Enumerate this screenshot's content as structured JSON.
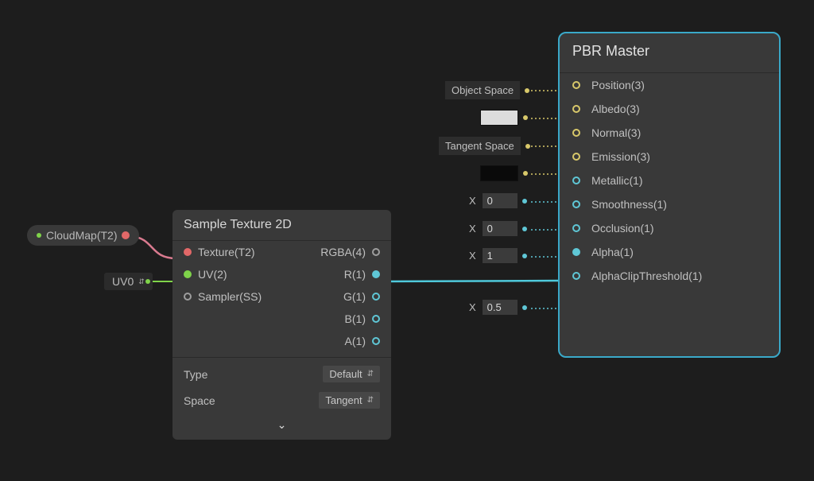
{
  "cloudmap": {
    "label": "CloudMap(T2)"
  },
  "uv_pill": {
    "label": "UV0"
  },
  "sample_node": {
    "title": "Sample Texture 2D",
    "inputs": {
      "texture": "Texture(T2)",
      "uv": "UV(2)",
      "sampler": "Sampler(SS)"
    },
    "outputs": {
      "rgba": "RGBA(4)",
      "r": "R(1)",
      "g": "G(1)",
      "b": "B(1)",
      "a": "A(1)"
    },
    "settings": {
      "type_label": "Type",
      "type_value": "Default",
      "space_label": "Space",
      "space_value": "Tangent"
    }
  },
  "pbr_node": {
    "title": "PBR Master",
    "inputs": {
      "position": "Position(3)",
      "albedo": "Albedo(3)",
      "normal": "Normal(3)",
      "emission": "Emission(3)",
      "metallic": "Metallic(1)",
      "smoothness": "Smoothness(1)",
      "occlusion": "Occlusion(1)",
      "alpha": "Alpha(1)",
      "alphaclip": "AlphaClipThreshold(1)"
    }
  },
  "pbr_external": {
    "position_space": "Object Space",
    "normal_space": "Tangent Space",
    "metallic": "0",
    "smoothness": "0",
    "occlusion": "1",
    "alphaclip": "0.5",
    "x_label": "X"
  }
}
